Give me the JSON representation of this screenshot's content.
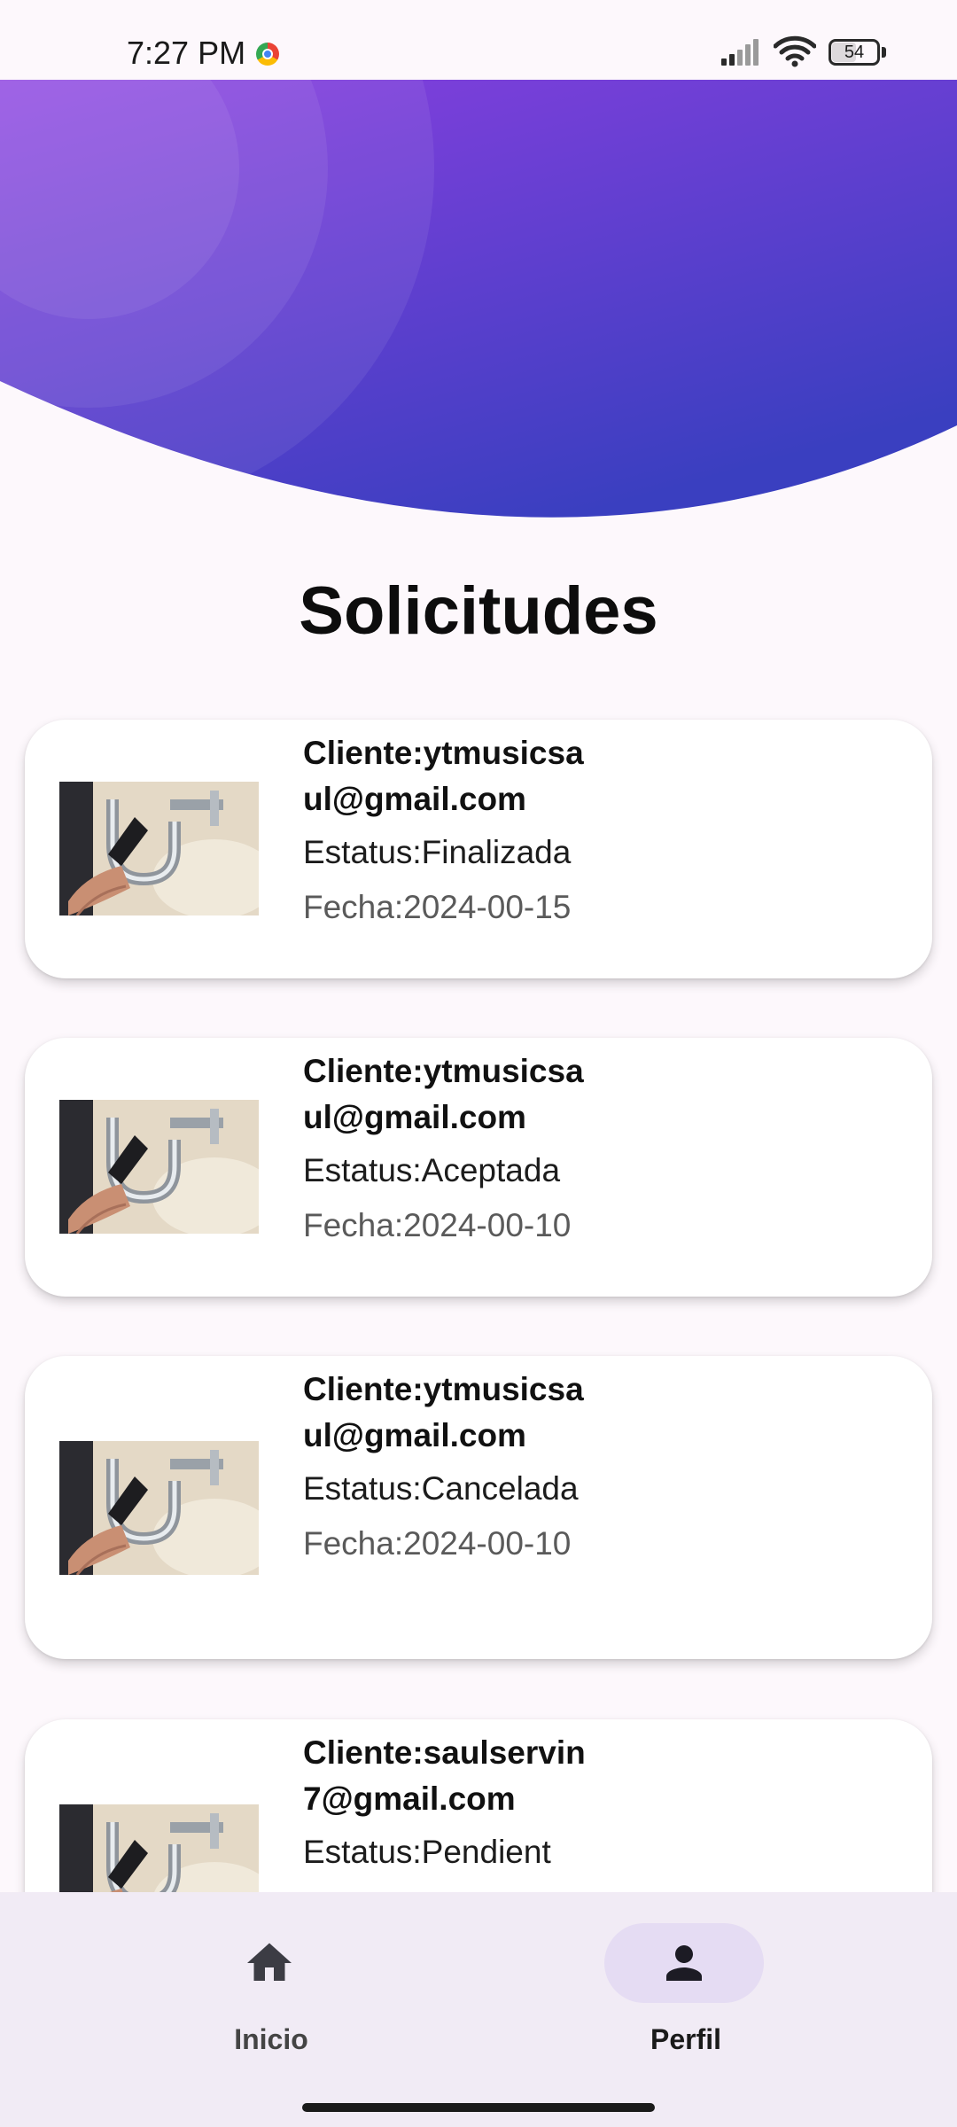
{
  "status_bar": {
    "time": "7:27 PM",
    "battery": "54",
    "battery_level": 0.54,
    "icons": [
      "chrome-icon",
      "signal-icon",
      "wifi-icon",
      "battery-icon"
    ]
  },
  "page": {
    "title": "Solicitudes"
  },
  "colors": {
    "header_gradient_start": "#8a3fe0",
    "header_gradient_end": "#3a3fc0",
    "nav_active_pill": "#e5dcf3",
    "background": "#fdf8fc"
  },
  "requests": [
    {
      "client": "Cliente:ytmusicsaul@gmail.com",
      "status": "Estatus:Finalizada",
      "date": "Fecha:2024-00-15"
    },
    {
      "client": "Cliente:ytmusicsaul@gmail.com",
      "status": "Estatus:Aceptada",
      "date": "Fecha:2024-00-10"
    },
    {
      "client": "Cliente:ytmusicsaul@gmail.com",
      "status": "Estatus:Cancelada",
      "date": "Fecha:2024-00-10"
    },
    {
      "client": "Cliente:saulservin7@gmail.com",
      "status": "Estatus:Pendient",
      "date": ""
    }
  ],
  "bottom_nav": {
    "items": [
      {
        "label": "Inicio",
        "icon": "home-icon",
        "active": false
      },
      {
        "label": "Perfil",
        "icon": "person-icon",
        "active": true
      }
    ]
  }
}
